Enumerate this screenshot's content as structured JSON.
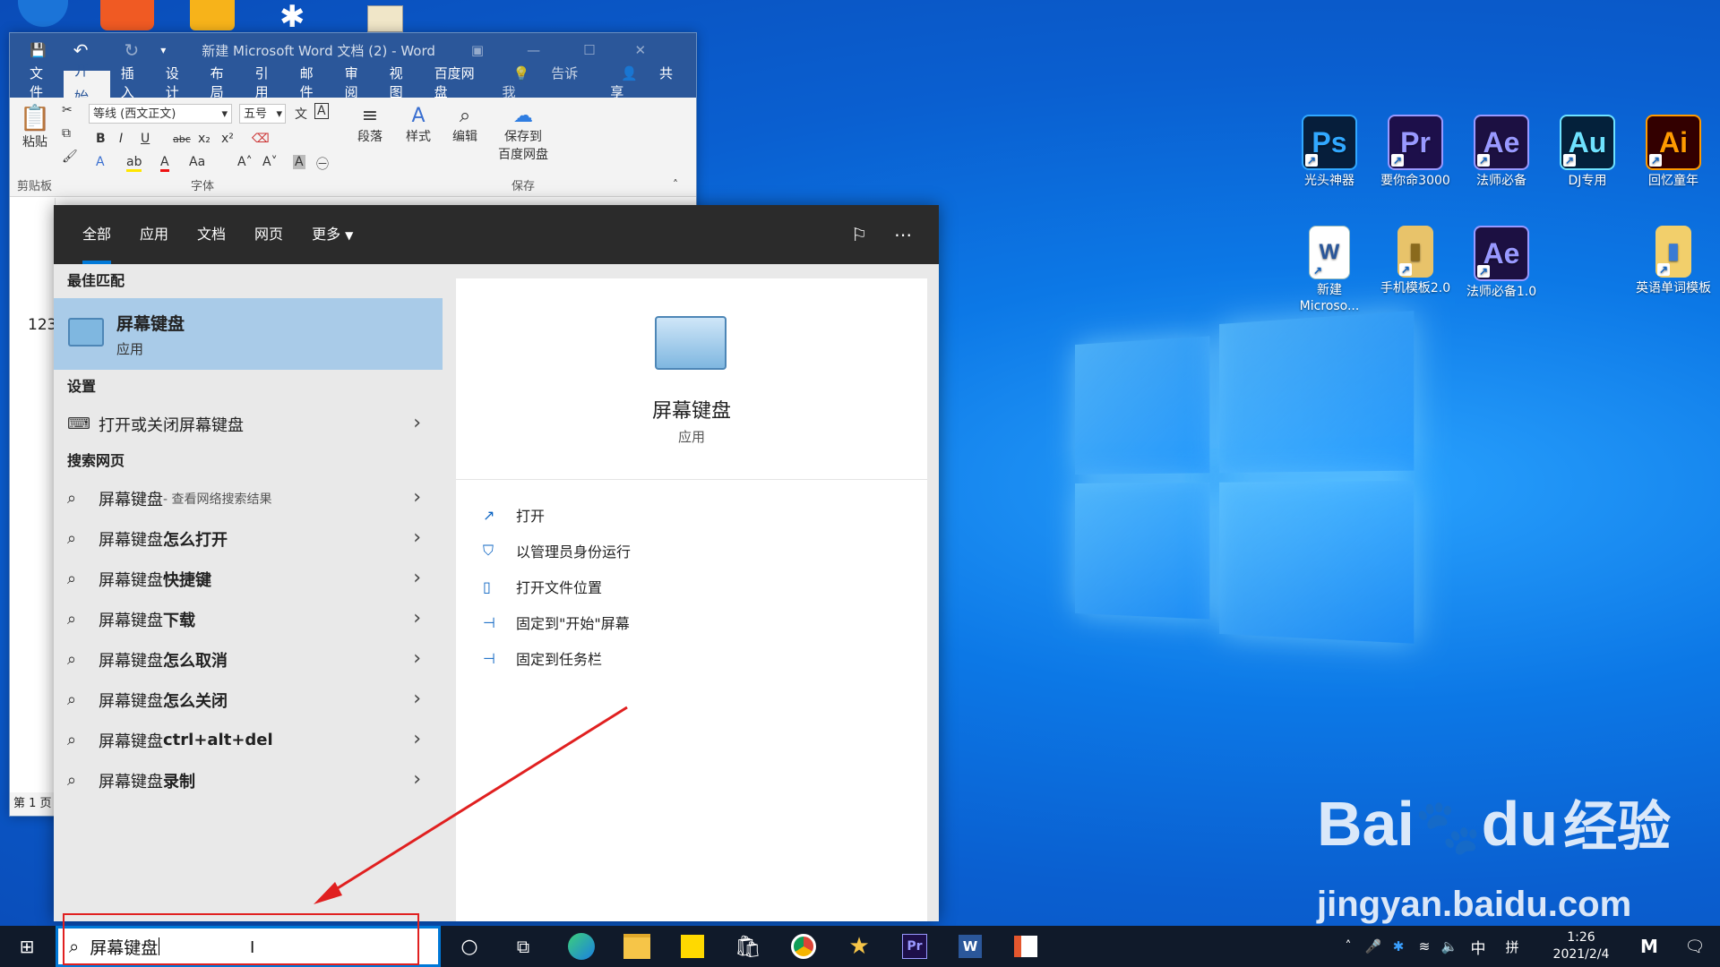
{
  "colors": {
    "word_blue": "#2b579a",
    "accent": "#0078d7",
    "highlight": "#a9cbe8",
    "annotation_red": "#e02020"
  },
  "desktop_icons": [
    {
      "label": "光头神器",
      "glyph": "Ps",
      "bg": "#061e3b",
      "fg": "#31a8ff",
      "icon": "photoshop-icon"
    },
    {
      "label": "要你命3000",
      "glyph": "Pr",
      "bg": "#1d0f4a",
      "fg": "#9999ff",
      "icon": "premiere-icon"
    },
    {
      "label": "法师必备",
      "glyph": "Ae",
      "bg": "#1c1042",
      "fg": "#9999ff",
      "icon": "after-effects-icon"
    },
    {
      "label": "DJ专用",
      "glyph": "Au",
      "bg": "#04213b",
      "fg": "#6ee2ff",
      "icon": "audition-icon"
    },
    {
      "label": "回忆童年",
      "glyph": "Ai",
      "bg": "#330000",
      "fg": "#ff9a00",
      "icon": "illustrator-icon"
    },
    {
      "label": "新建 Microso...",
      "glyph": "W",
      "bg": "#ffffff",
      "fg": "#2b579a",
      "icon": "word-document-icon"
    },
    {
      "label": "手机模板2.0",
      "glyph": "▮",
      "bg": "#e8c36a",
      "fg": "#8a6a1d",
      "icon": "folder-icon"
    },
    {
      "label": "法师必备1.0",
      "glyph": "Ae",
      "bg": "#1c1042",
      "fg": "#9999ff",
      "icon": "after-effects-icon"
    },
    {
      "label": "英语单词模板",
      "glyph": "▮",
      "bg": "#f2cf6b",
      "fg": "#3a7bd5",
      "icon": "folder-icon"
    }
  ],
  "word": {
    "title": "新建 Microsoft Word 文档 (2) - Word",
    "tabs": [
      "文件",
      "开始",
      "插入",
      "设计",
      "布局",
      "引用",
      "邮件",
      "审阅",
      "视图",
      "百度网盘"
    ],
    "tell_me": "告诉我",
    "share": "共享",
    "font_name": "等线 (西文正文)",
    "font_size": "五号",
    "paste": "粘贴",
    "groups": {
      "clipboard": "剪贴板",
      "font": "字体",
      "save": "保存"
    },
    "paragraph": "段落",
    "styles": "样式",
    "editing": "编辑",
    "save_to_baidu": "保存到\n百度网盘",
    "doc_text": "123",
    "page_status": "第 1 页"
  },
  "search": {
    "tabs": [
      "全部",
      "应用",
      "文档",
      "网页",
      "更多"
    ],
    "best_match_header": "最佳匹配",
    "best_match": {
      "title": "屏幕键盘",
      "subtitle": "应用"
    },
    "settings_header": "设置",
    "settings_item": "打开或关闭屏幕键盘",
    "web_header": "搜索网页",
    "web_items": [
      {
        "base": "屏幕键盘",
        "bold": "",
        "suffix": " - 查看网络搜索结果"
      },
      {
        "base": "屏幕键盘",
        "bold": "怎么打开",
        "suffix": ""
      },
      {
        "base": "屏幕键盘 ",
        "bold": "快捷键",
        "suffix": ""
      },
      {
        "base": "屏幕键盘",
        "bold": "下载",
        "suffix": ""
      },
      {
        "base": "屏幕键盘",
        "bold": "怎么取消",
        "suffix": ""
      },
      {
        "base": "屏幕键盘",
        "bold": "怎么关闭",
        "suffix": ""
      },
      {
        "base": "屏幕键盘 ",
        "bold": "ctrl+alt+del",
        "suffix": ""
      },
      {
        "base": "屏幕键盘",
        "bold": "录制",
        "suffix": ""
      }
    ],
    "preview": {
      "title": "屏幕键盘",
      "subtitle": "应用"
    },
    "actions": [
      "打开",
      "以管理员身份运行",
      "打开文件位置",
      "固定到\"开始\"屏幕",
      "固定到任务栏"
    ],
    "query": "屏幕键盘"
  },
  "taskbar": {
    "ime": "中",
    "ime_mode": "拼",
    "time": "1:26",
    "date": "2021/2/4"
  },
  "watermark": {
    "logo": "Bai",
    "logo2": "du",
    "brand": "经验",
    "url": "jingyan.baidu.com"
  }
}
